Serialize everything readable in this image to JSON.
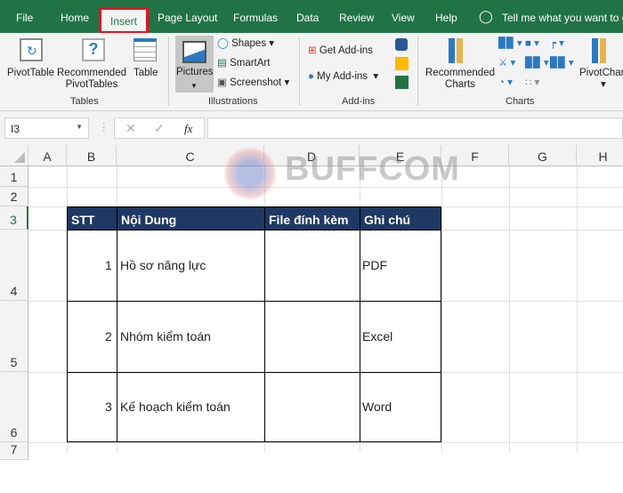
{
  "tabs": [
    "File",
    "Home",
    "Insert",
    "Page Layout",
    "Formulas",
    "Data",
    "Review",
    "View",
    "Help"
  ],
  "active_tab": "Insert",
  "tell_me": "Tell me what you want to do",
  "ribbon": {
    "tables": {
      "pivottable": "PivotTable",
      "recommended_pivot": "Recommended",
      "recommended_pivot2": "PivotTables",
      "table": "Table",
      "group": "Tables"
    },
    "illustrations": {
      "pictures": "Pictures",
      "shapes": "Shapes",
      "smartart": "SmartArt",
      "screenshot": "Screenshot",
      "group": "Illustrations"
    },
    "addins": {
      "get": "Get Add-ins",
      "my": "My Add-ins",
      "group": "Add-ins"
    },
    "charts": {
      "recommended": "Recommended",
      "recommended2": "Charts",
      "pivotchart": "PivotChart",
      "group": "Charts"
    }
  },
  "name_box": "I3",
  "formula": "",
  "columns": [
    "A",
    "B",
    "C",
    "D",
    "E",
    "F",
    "G",
    "H"
  ],
  "rows": [
    "1",
    "2",
    "3",
    "4",
    "5",
    "6",
    "7"
  ],
  "watermark": "BUFFCOM",
  "table": {
    "headers": [
      "STT",
      "Nội Dung",
      "File đính kèm",
      "Ghi chú"
    ],
    "rows": [
      {
        "stt": "1",
        "content": "Hồ sơ năng lực",
        "file": "",
        "note": "PDF"
      },
      {
        "stt": "2",
        "content": "Nhóm kiểm toán",
        "file": "",
        "note": "Excel"
      },
      {
        "stt": "3",
        "content": "Kế hoạch kiểm toán",
        "file": "",
        "note": "Word"
      }
    ]
  },
  "colors": {
    "excel_green": "#217346",
    "header_fill": "#1f3864",
    "highlight": "#e81123"
  }
}
